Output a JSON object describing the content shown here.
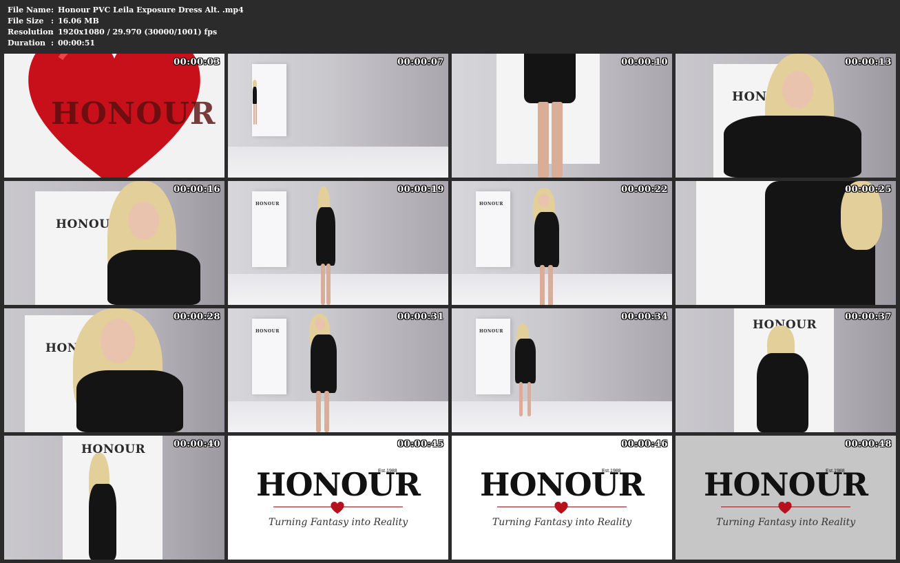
{
  "info": {
    "rows": [
      {
        "label": "File Name",
        "value": "Honour PVC Leila Exposure Dress Alt. .mp4"
      },
      {
        "label": "File Size",
        "value": "16.06 MB"
      },
      {
        "label": "Resolution",
        "value": "1920x1080 / 29.970 (30000/1001) fps"
      },
      {
        "label": "Duration",
        "value": "00:00:51"
      }
    ],
    "separator": ":"
  },
  "thumbnails": [
    {
      "timestamp": "00:00:03"
    },
    {
      "timestamp": "00:00:07"
    },
    {
      "timestamp": "00:00:10"
    },
    {
      "timestamp": "00:00:13"
    },
    {
      "timestamp": "00:00:16"
    },
    {
      "timestamp": "00:00:19"
    },
    {
      "timestamp": "00:00:22"
    },
    {
      "timestamp": "00:00:25"
    },
    {
      "timestamp": "00:00:28"
    },
    {
      "timestamp": "00:00:31"
    },
    {
      "timestamp": "00:00:34"
    },
    {
      "timestamp": "00:00:37"
    },
    {
      "timestamp": "00:00:40"
    },
    {
      "timestamp": "00:00:45"
    },
    {
      "timestamp": "00:00:46"
    },
    {
      "timestamp": "00:00:48"
    }
  ],
  "brand": {
    "logo_text": "HONOUR",
    "est": "Est.1988",
    "tagline": "Turning Fantasy into Reality"
  },
  "colors": {
    "background": "#2b2b2b",
    "heart_red": "#c8101a",
    "brand_red": "#b5121b"
  }
}
